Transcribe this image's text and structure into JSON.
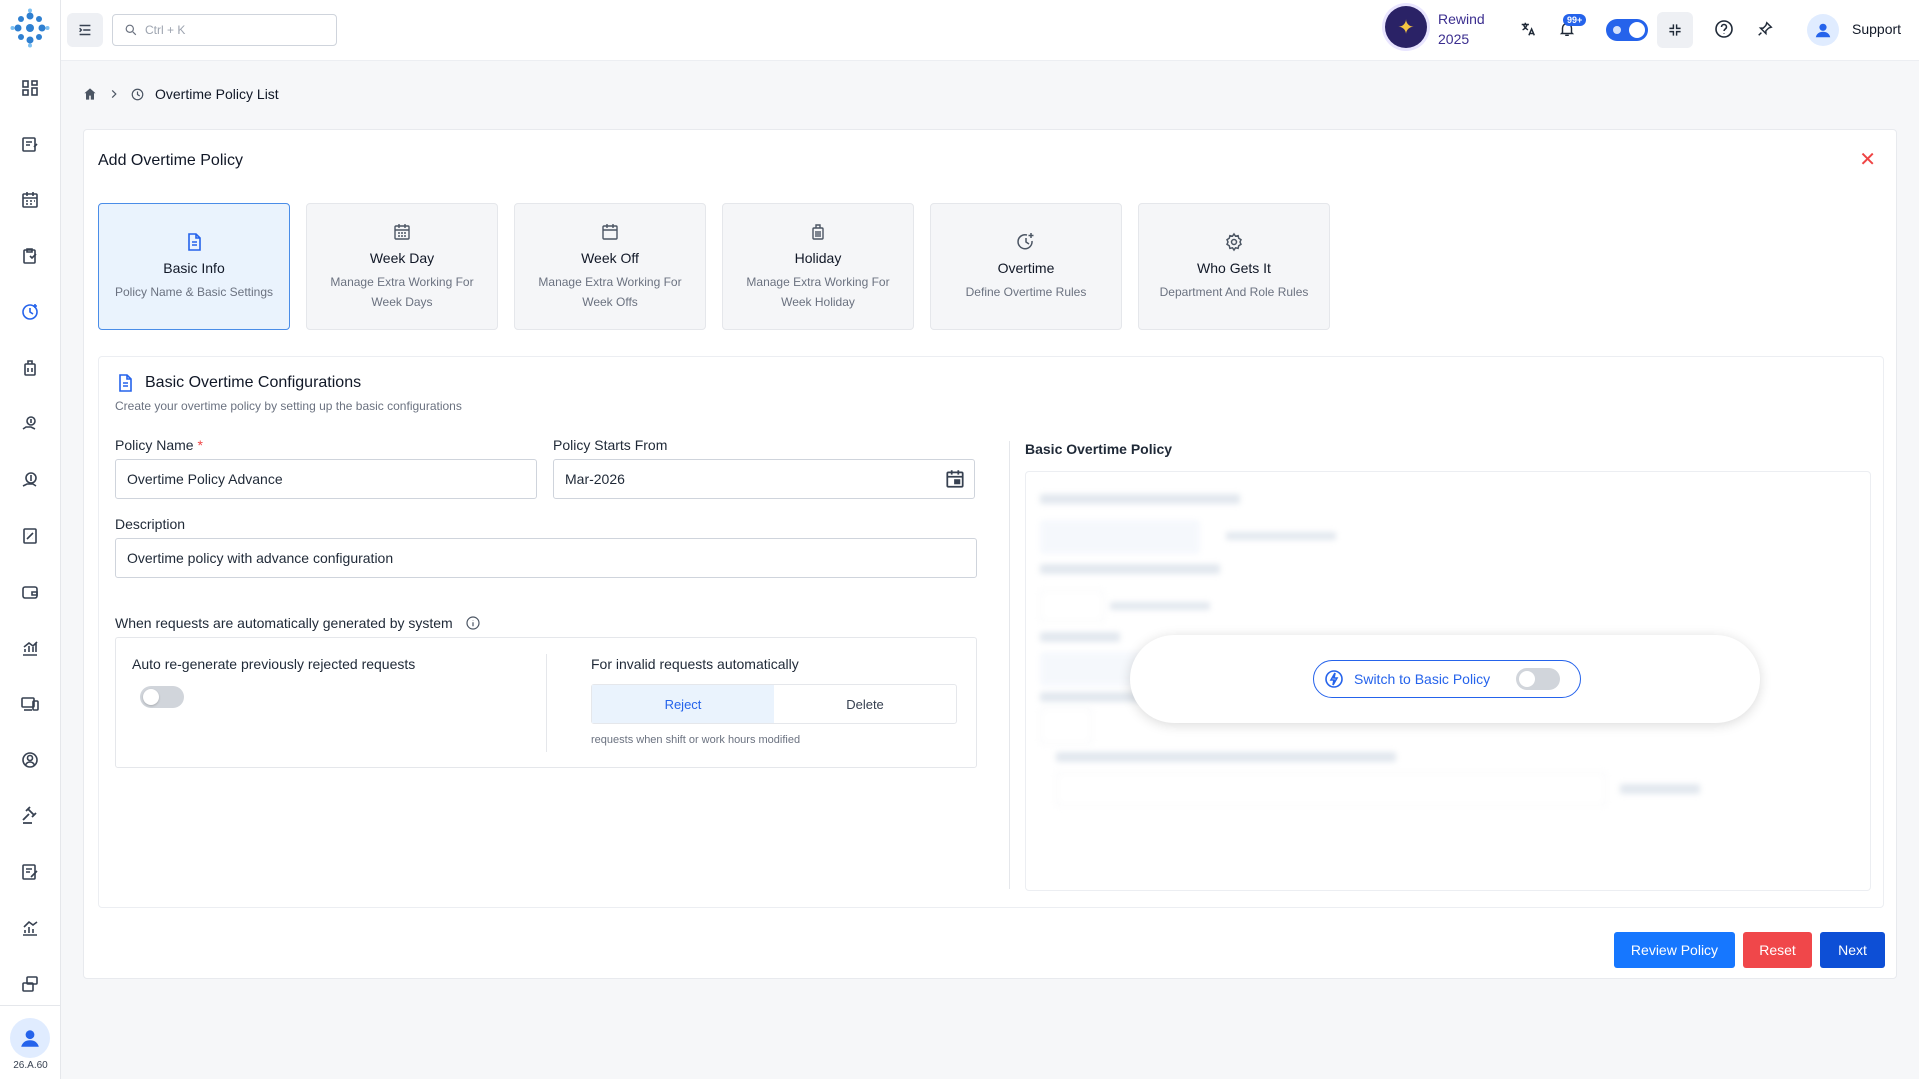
{
  "app": {
    "version": "26.A.60"
  },
  "topbar": {
    "search_placeholder": "Ctrl + K",
    "rewind_line1": "Rewind",
    "rewind_line2": "2025",
    "notifications_badge": "99+",
    "support_label": "Support"
  },
  "breadcrumb": {
    "title": "Overtime Policy List"
  },
  "card": {
    "title": "Add Overtime Policy"
  },
  "steps": [
    {
      "title": "Basic Info",
      "desc": "Policy Name & Basic Settings",
      "icon": "document-icon",
      "active": true
    },
    {
      "title": "Week Day",
      "desc": "Manage Extra Working For Week Days",
      "icon": "calendar-grid-icon",
      "active": false
    },
    {
      "title": "Week Off",
      "desc": "Manage Extra Working For Week Offs",
      "icon": "calendar-icon",
      "active": false
    },
    {
      "title": "Holiday",
      "desc": "Manage Extra Working For Week Holiday",
      "icon": "luggage-icon",
      "active": false
    },
    {
      "title": "Overtime",
      "desc": "Define Overtime Rules",
      "icon": "clock-plus-icon",
      "active": false
    },
    {
      "title": "Who Gets It",
      "desc": "Department And Role Rules",
      "icon": "gear-icon",
      "active": false
    }
  ],
  "section": {
    "title": "Basic Overtime Configurations",
    "subtitle": "Create your overtime policy by setting up the basic configurations"
  },
  "form": {
    "policy_name_label": "Policy Name",
    "policy_name_required": "*",
    "policy_name_value": "Overtime Policy Advance",
    "starts_from_label": "Policy Starts From",
    "starts_from_value": "Mar-2026",
    "description_label": "Description",
    "description_value": "Overtime policy with advance configuration",
    "auto_title": "When requests are automatically generated by system",
    "regenerate_label": "Auto re-generate previously rejected requests",
    "regenerate_on": false,
    "invalid_label": "For invalid requests automatically",
    "invalid_options": [
      "Reject",
      "Delete"
    ],
    "invalid_selected": "Reject",
    "invalid_hint": "requests when shift or work hours modified"
  },
  "basic_policy": {
    "title": "Basic Overtime Policy",
    "switch_label": "Switch to Basic Policy",
    "switch_on": false
  },
  "buttons": {
    "review": "Review Policy",
    "reset": "Reset",
    "next": "Next"
  },
  "colors": {
    "primary": "#1677ff",
    "primary_dark": "#0d4fd6",
    "danger": "#f0474a",
    "active_step_bg": "#eaf3fd"
  }
}
